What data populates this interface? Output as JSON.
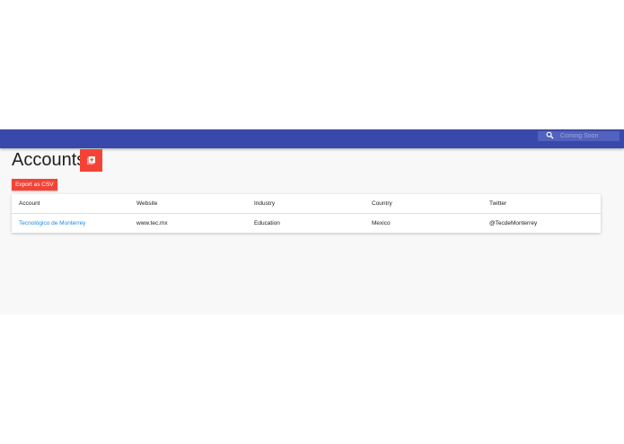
{
  "colors": {
    "topbar": "#3949ab",
    "search_bg": "#5262bd",
    "accent": "#f44336",
    "link": "#1e88e5",
    "page_bg": "#f8f8f8"
  },
  "search": {
    "placeholder": "Coming Soon",
    "icon": "search-icon"
  },
  "page": {
    "title": "Accounts",
    "add_icon": "add-box-icon",
    "export_label": "Export as CSV"
  },
  "table": {
    "columns": [
      "Account",
      "Website",
      "Industry",
      "Country",
      "Twitter"
    ],
    "rows": [
      {
        "account": "Tecnológico de Monterrey",
        "website": "www.tec.mx",
        "industry": "Education",
        "country": "Mexico",
        "twitter": "@TecdeMonterrey"
      }
    ]
  }
}
